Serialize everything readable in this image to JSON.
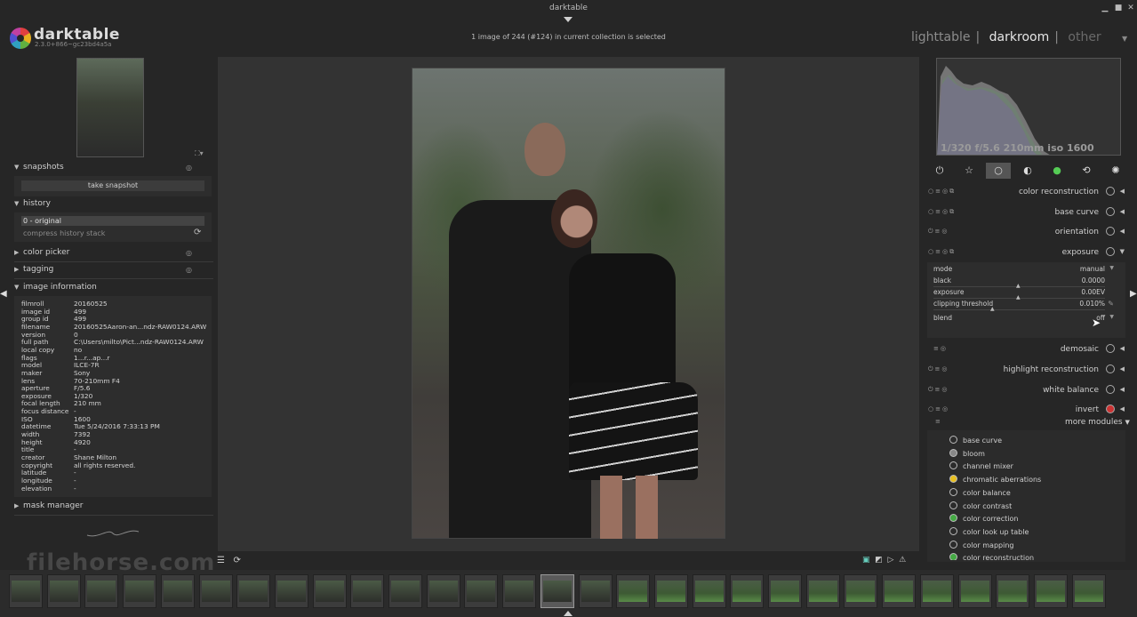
{
  "window": {
    "title": "darktable"
  },
  "logo": {
    "name": "darktable",
    "version": "2.3.0+866~gc23bd4a5a"
  },
  "collection_info": "1 image of 244 (#124) in current collection is selected",
  "view_switcher": {
    "items": [
      "lighttable",
      "darkroom",
      "other"
    ],
    "separator": "|",
    "active": "darkroom"
  },
  "left": {
    "snapshots": {
      "label": "snapshots",
      "button": "take snapshot"
    },
    "history": {
      "label": "history",
      "item": "0 - original",
      "compress": "compress history stack"
    },
    "color_picker": {
      "label": "color picker"
    },
    "tagging": {
      "label": "tagging"
    },
    "image_information": {
      "label": "image information",
      "rows": [
        {
          "k": "filmroll",
          "v": "20160525"
        },
        {
          "k": "image id",
          "v": "499"
        },
        {
          "k": "group id",
          "v": "499"
        },
        {
          "k": "filename",
          "v": "20160525Aaron-an...ndz-RAW0124.ARW"
        },
        {
          "k": "version",
          "v": "0"
        },
        {
          "k": "full path",
          "v": "C:\\Users\\milto\\Pict...ndz-RAW0124.ARW"
        },
        {
          "k": "local copy",
          "v": "no"
        },
        {
          "k": "flags",
          "v": "1...r...ap...r"
        },
        {
          "k": "model",
          "v": "ILCE-7R"
        },
        {
          "k": "maker",
          "v": "Sony"
        },
        {
          "k": "lens",
          "v": "70-210mm F4"
        },
        {
          "k": "aperture",
          "v": "F/5.6"
        },
        {
          "k": "exposure",
          "v": "1/320"
        },
        {
          "k": "focal length",
          "v": "210 mm"
        },
        {
          "k": "focus distance",
          "v": "-"
        },
        {
          "k": "ISO",
          "v": "1600"
        },
        {
          "k": "datetime",
          "v": "Tue 5/24/2016 7:33:13 PM"
        },
        {
          "k": "width",
          "v": "7392"
        },
        {
          "k": "height",
          "v": "4920"
        },
        {
          "k": "title",
          "v": "-"
        },
        {
          "k": "creator",
          "v": "Shane Milton"
        },
        {
          "k": "copyright",
          "v": "all rights reserved."
        },
        {
          "k": "latitude",
          "v": "-"
        },
        {
          "k": "longitude",
          "v": "-"
        },
        {
          "k": "elevation",
          "v": "-"
        }
      ]
    },
    "mask_manager": {
      "label": "mask manager"
    }
  },
  "histogram": {
    "info": "1/320 f/5.6 210mm iso 1600"
  },
  "modules": [
    {
      "name": "color reconstruction"
    },
    {
      "name": "base curve"
    },
    {
      "name": "orientation"
    },
    {
      "name": "exposure"
    }
  ],
  "exposure": {
    "rows": [
      {
        "label": "mode",
        "value": "manual"
      },
      {
        "label": "black",
        "value": "0.0000"
      },
      {
        "label": "exposure",
        "value": "0.00EV"
      },
      {
        "label": "clipping threshold",
        "value": "0.010%"
      },
      {
        "label": "blend",
        "value": "off"
      }
    ]
  },
  "modules_after": [
    {
      "name": "demosaic"
    },
    {
      "name": "highlight reconstruction"
    },
    {
      "name": "white balance"
    },
    {
      "name": "invert"
    }
  ],
  "more_modules": {
    "label": "more modules",
    "items": [
      "base curve",
      "bloom",
      "channel mixer",
      "chromatic aberrations",
      "color balance",
      "color contrast",
      "color correction",
      "color look up table",
      "color mapping",
      "color reconstruction"
    ]
  },
  "watermark": "filehorse.com",
  "colors": {
    "background": "#262626",
    "panel": "#2d2d2d",
    "center": "#333333",
    "text": "#c8c8c8"
  }
}
